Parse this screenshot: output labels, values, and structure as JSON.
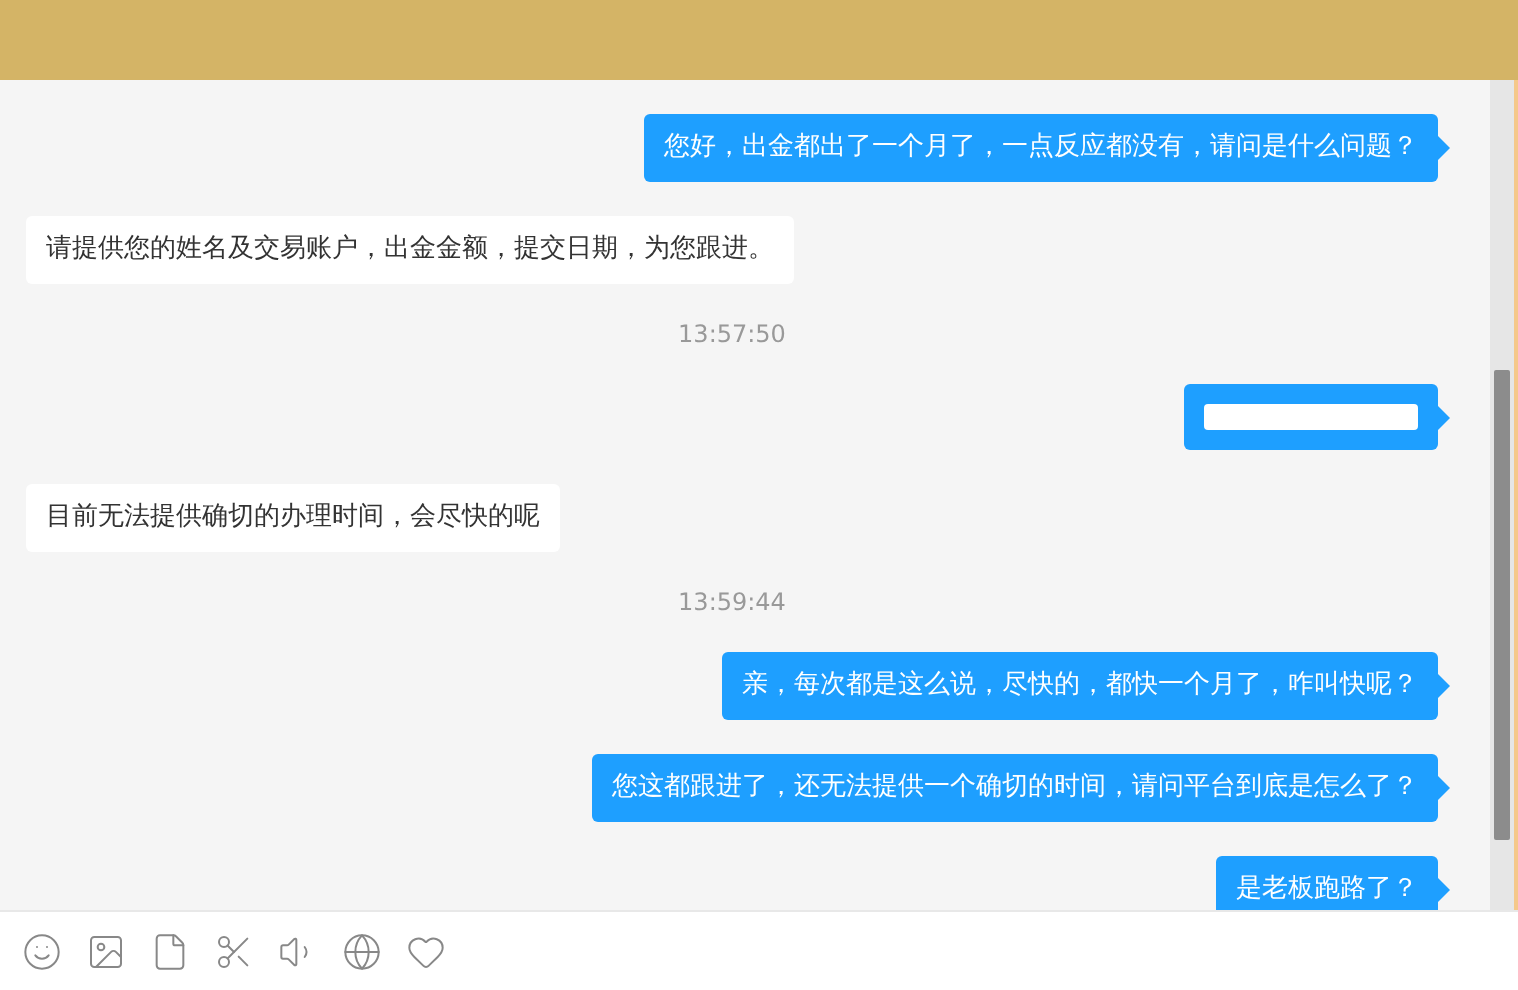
{
  "messages": [
    {
      "kind": "sent",
      "text": "您好，出金都出了一个月了，一点反应都没有，请问是什么问题？"
    },
    {
      "kind": "received",
      "text": "请提供您的姓名及交易账户，出金金额，提交日期，为您跟进。"
    },
    {
      "kind": "time",
      "text": "13:57:50"
    },
    {
      "kind": "sent_image"
    },
    {
      "kind": "received",
      "text": "目前无法提供确切的办理时间，会尽快的呢"
    },
    {
      "kind": "time",
      "text": "13:59:44"
    },
    {
      "kind": "sent",
      "text": "亲，每次都是这么说，尽快的，都快一个月了，咋叫快呢？"
    },
    {
      "kind": "sent",
      "text": "您这都跟进了，还无法提供一个确切的时间，请问平台到底是怎么了？"
    },
    {
      "kind": "sent",
      "text": "是老板跑路了？"
    }
  ]
}
